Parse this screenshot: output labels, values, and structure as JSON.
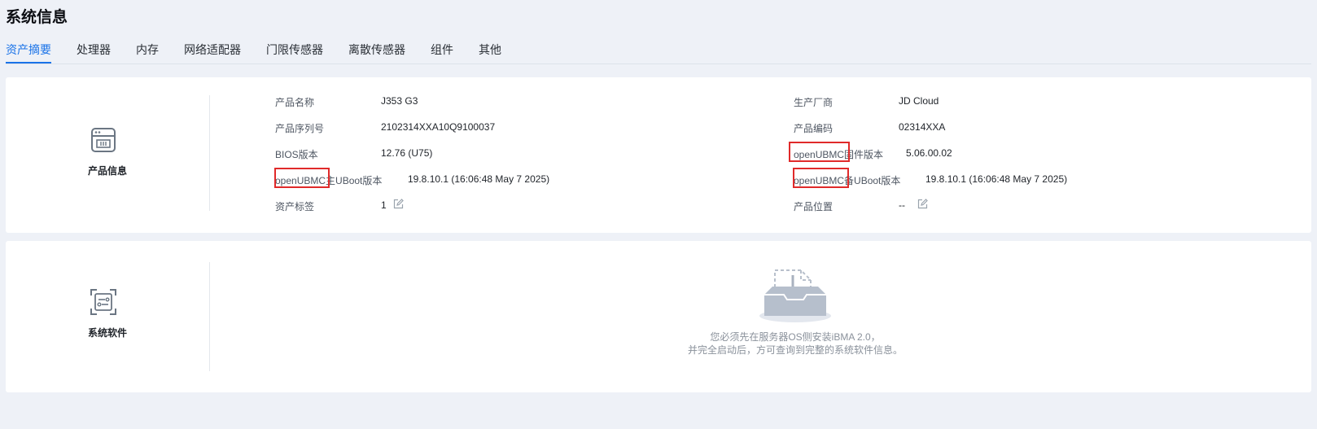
{
  "page": {
    "title": "系统信息"
  },
  "tabs": [
    {
      "label": "资产摘要",
      "active": true
    },
    {
      "label": "处理器",
      "active": false
    },
    {
      "label": "内存",
      "active": false
    },
    {
      "label": "网络适配器",
      "active": false
    },
    {
      "label": "门限传感器",
      "active": false
    },
    {
      "label": "离散传感器",
      "active": false
    },
    {
      "label": "组件",
      "active": false
    },
    {
      "label": "其他",
      "active": false
    }
  ],
  "product_info": {
    "title": "产品信息",
    "icon": "server-icon",
    "fields": {
      "product_name": {
        "label": "产品名称",
        "value": "J353 G3"
      },
      "manufacturer": {
        "label": "生产厂商",
        "value": "JD Cloud"
      },
      "serial_number": {
        "label": "产品序列号",
        "value": "2102314XXA10Q9100037"
      },
      "product_code": {
        "label": "产品编码",
        "value": "02314XXA"
      },
      "bios_version": {
        "label": "BIOS版本",
        "value": "12.76 (U75)"
      },
      "firmware_version": {
        "label_prefix": "openUBMC",
        "label_suffix": "固件版本",
        "value": "5.06.00.02"
      },
      "main_uboot": {
        "label_prefix": "openUBMC",
        "label_suffix": "主UBoot版本",
        "value": "19.8.10.1 (16:06:48 May  7 2025)"
      },
      "backup_uboot": {
        "label_prefix": "openUBMC",
        "label_suffix": "备UBoot版本",
        "value": "19.8.10.1 (16:06:48 May  7 2025)"
      },
      "asset_tag": {
        "label": "资产标签",
        "value": "1"
      },
      "product_location": {
        "label": "产品位置",
        "value": "--"
      }
    }
  },
  "system_software": {
    "title": "系统软件",
    "icon": "software-icon",
    "empty_line1": "您必须先在服务器OS侧安装iBMA 2.0，",
    "empty_line2": "并完全启动后，方可查询到完整的系统软件信息。"
  },
  "colors": {
    "accent": "#1a73e8",
    "highlight": "#e02a2a",
    "background": "#eef1f7"
  }
}
